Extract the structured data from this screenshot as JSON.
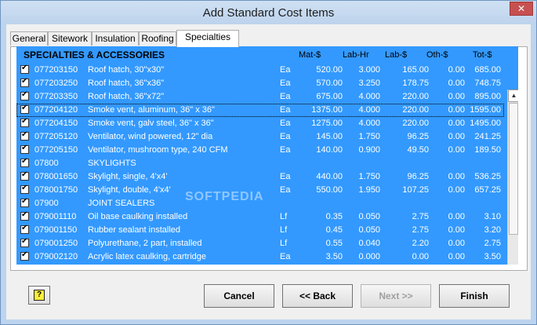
{
  "window": {
    "title": "Add Standard Cost Items",
    "close_glyph": "✕"
  },
  "tabs": [
    {
      "label": "General"
    },
    {
      "label": "Sitework"
    },
    {
      "label": "Insulation"
    },
    {
      "label": "Roofing"
    },
    {
      "label": "Specialties"
    }
  ],
  "active_tab": "Specialties",
  "list": {
    "section_title": "SPECIALTIES & ACCESSORIES",
    "columns": {
      "mat": "Mat-$",
      "labhr": "Lab-Hr",
      "lab": "Lab-$",
      "oth": "Oth-$",
      "tot": "Tot-$"
    },
    "rows": [
      {
        "code": "077203150",
        "desc": "Roof hatch, 30\"x30\"",
        "unit": "Ea",
        "mat": "520.00",
        "labhr": "3.000",
        "lab": "165.00",
        "oth": "0.00",
        "tot": "685.00"
      },
      {
        "code": "077203250",
        "desc": "Roof hatch, 36\"x36\"",
        "unit": "Ea",
        "mat": "570.00",
        "labhr": "3.250",
        "lab": "178.75",
        "oth": "0.00",
        "tot": "748.75"
      },
      {
        "code": "077203350",
        "desc": "Roof hatch, 36\"x72\"",
        "unit": "Ea",
        "mat": "675.00",
        "labhr": "4.000",
        "lab": "220.00",
        "oth": "0.00",
        "tot": "895.00"
      },
      {
        "code": "077204120",
        "desc": "Smoke vent, aluminum, 36\" x 36\"",
        "unit": "Ea",
        "mat": "1375.00",
        "labhr": "4.000",
        "lab": "220.00",
        "oth": "0.00",
        "tot": "1595.00"
      },
      {
        "code": "077204150",
        "desc": "Smoke vent, galv steel, 36\" x 36\"",
        "unit": "Ea",
        "mat": "1275.00",
        "labhr": "4.000",
        "lab": "220.00",
        "oth": "0.00",
        "tot": "1495.00"
      },
      {
        "code": "077205120",
        "desc": "Ventilator, wind powered, 12\" dia",
        "unit": "Ea",
        "mat": "145.00",
        "labhr": "1.750",
        "lab": "96.25",
        "oth": "0.00",
        "tot": "241.25"
      },
      {
        "code": "077205150",
        "desc": "Ventilator, mushroom type, 240 CFM",
        "unit": "Ea",
        "mat": "140.00",
        "labhr": "0.900",
        "lab": "49.50",
        "oth": "0.00",
        "tot": "189.50"
      },
      {
        "code": "07800",
        "desc": "SKYLIGHTS",
        "unit": "",
        "mat": "",
        "labhr": "",
        "lab": "",
        "oth": "",
        "tot": ""
      },
      {
        "code": "078001650",
        "desc": "Skylight, single, 4'x4'",
        "unit": "Ea",
        "mat": "440.00",
        "labhr": "1.750",
        "lab": "96.25",
        "oth": "0.00",
        "tot": "536.25"
      },
      {
        "code": "078001750",
        "desc": "Skylight, double, 4'x4'",
        "unit": "Ea",
        "mat": "550.00",
        "labhr": "1.950",
        "lab": "107.25",
        "oth": "0.00",
        "tot": "657.25"
      },
      {
        "code": "07900",
        "desc": "JOINT SEALERS",
        "unit": "",
        "mat": "",
        "labhr": "",
        "lab": "",
        "oth": "",
        "tot": ""
      },
      {
        "code": "079001110",
        "desc": "Oil base caulking installed",
        "unit": "Lf",
        "mat": "0.35",
        "labhr": "0.050",
        "lab": "2.75",
        "oth": "0.00",
        "tot": "3.10"
      },
      {
        "code": "079001150",
        "desc": "Rubber sealant installed",
        "unit": "Lf",
        "mat": "0.45",
        "labhr": "0.050",
        "lab": "2.75",
        "oth": "0.00",
        "tot": "3.20"
      },
      {
        "code": "079001250",
        "desc": "Polyurethane, 2 part, installed",
        "unit": "Lf",
        "mat": "0.55",
        "labhr": "0.040",
        "lab": "2.20",
        "oth": "0.00",
        "tot": "2.75"
      },
      {
        "code": "079002120",
        "desc": "Acrylic latex caulking, cartridge",
        "unit": "Ea",
        "mat": "3.50",
        "labhr": "0.000",
        "lab": "0.00",
        "oth": "0.00",
        "tot": "3.50"
      }
    ]
  },
  "watermark": "SOFTPEDIA",
  "buttons": {
    "cancel": "Cancel",
    "back": "<< Back",
    "next": "Next >>",
    "finish": "Finish",
    "help_glyph": "?"
  },
  "colors": {
    "selection": "#3399ff",
    "title_bg": "#bcd4ee",
    "close": "#c75050"
  }
}
